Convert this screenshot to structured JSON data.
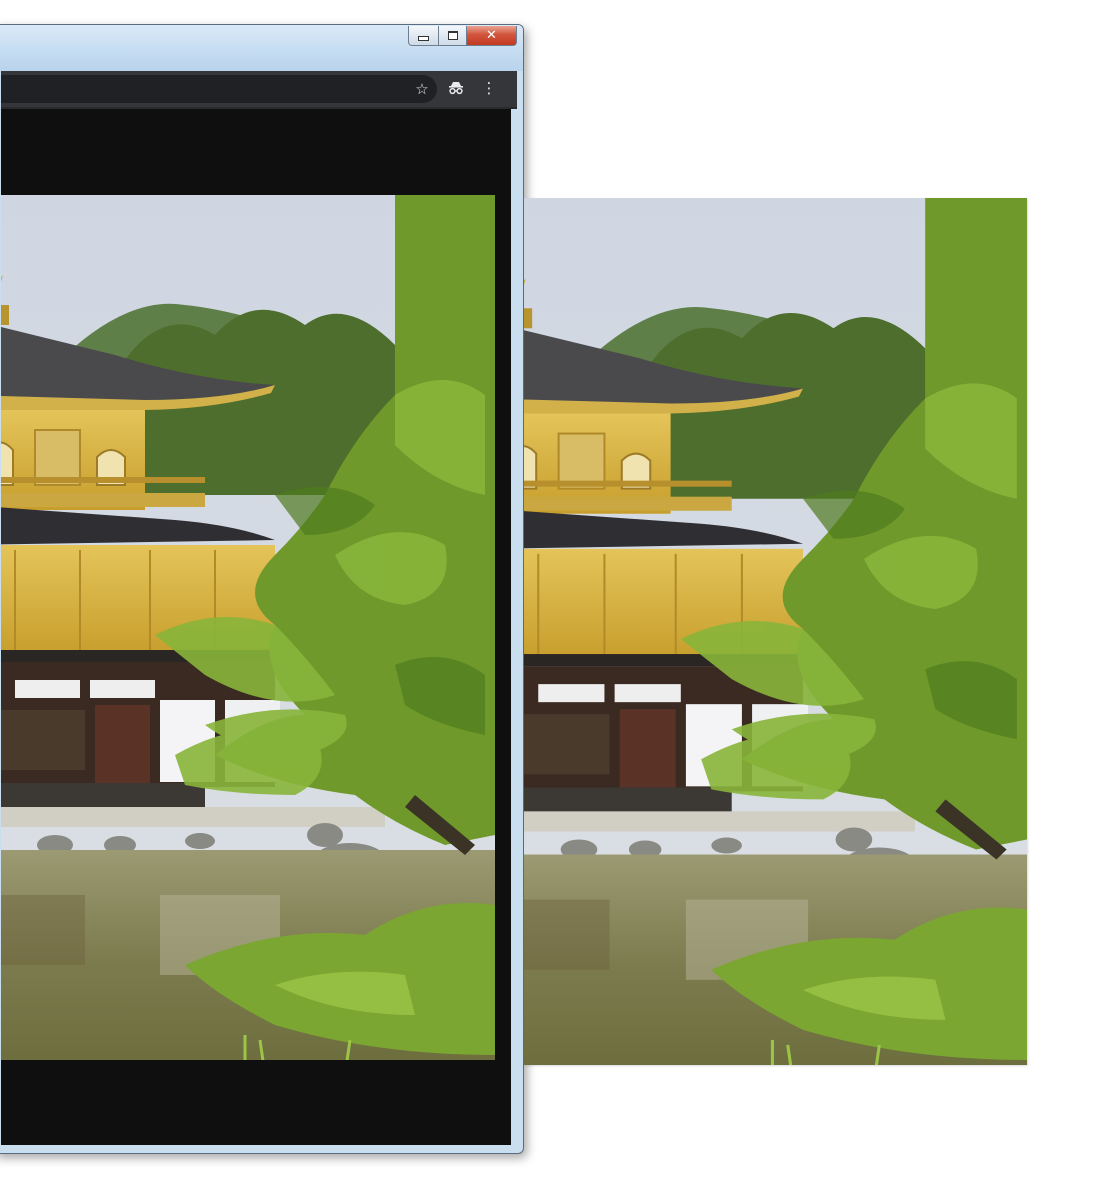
{
  "window": {
    "controls": {
      "minimize": "minimize-icon",
      "maximize": "maximize-icon",
      "close": "close-icon"
    },
    "toolbar_icons": [
      "star-icon",
      "incognito-icon",
      "kebab-menu-icon"
    ]
  },
  "photo": {
    "subject": "golden-pavilion-photo",
    "colors": {
      "sky": "#d6dbe4",
      "gold": "#d8b43c",
      "pine": "#6f9a2b",
      "water": "#8b8a5e",
      "roof": "#3f3f42"
    }
  }
}
